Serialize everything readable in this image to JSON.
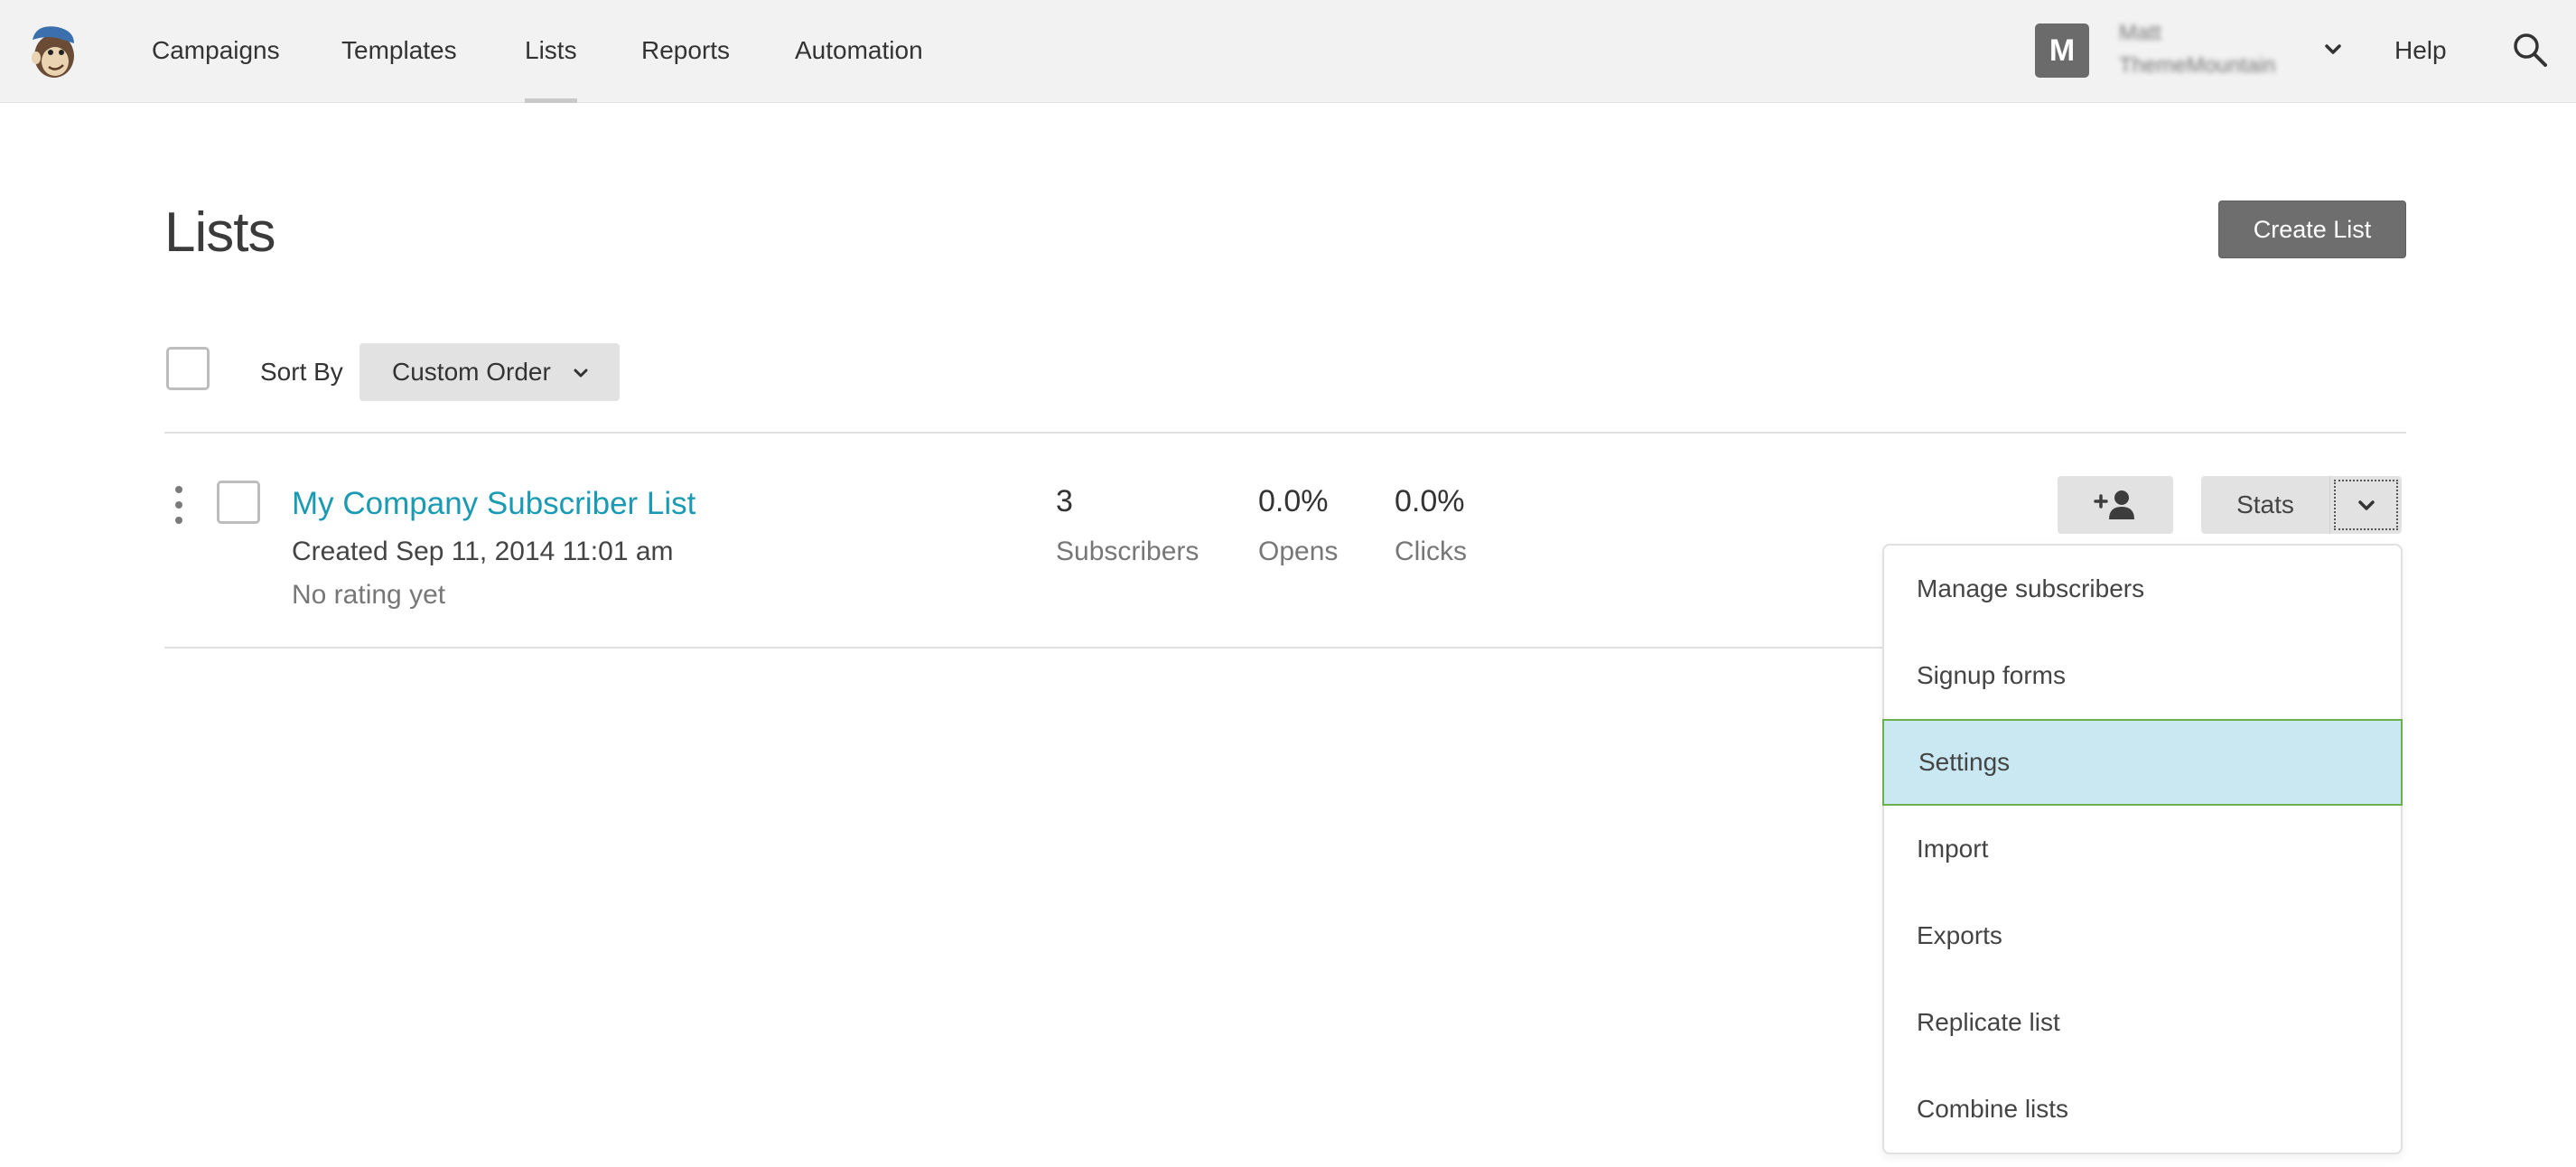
{
  "nav": {
    "items": [
      {
        "label": "Campaigns"
      },
      {
        "label": "Templates"
      },
      {
        "label": "Lists",
        "active": true
      },
      {
        "label": "Reports"
      },
      {
        "label": "Automation"
      }
    ],
    "user": {
      "initial": "M",
      "name": "Matt",
      "org": "ThemeMountain"
    },
    "help": "Help"
  },
  "page": {
    "title": "Lists",
    "create_button": "Create List",
    "sort_label": "Sort By",
    "sort_value": "Custom Order"
  },
  "list": {
    "name": "My Company Subscriber List",
    "created": "Created Sep 11, 2014 11:01 am",
    "rating": "No rating yet",
    "stats": [
      {
        "value": "3",
        "label": "Subscribers"
      },
      {
        "value": "0.0%",
        "label": "Opens"
      },
      {
        "value": "0.0%",
        "label": "Clicks"
      }
    ],
    "stats_button": "Stats"
  },
  "menu": {
    "items": [
      {
        "label": "Manage subscribers"
      },
      {
        "label": "Signup forms"
      },
      {
        "label": "Settings",
        "highlighted": true
      },
      {
        "label": "Import"
      },
      {
        "label": "Exports"
      },
      {
        "label": "Replicate list"
      },
      {
        "label": "Combine lists"
      }
    ]
  },
  "colors": {
    "link": "#1b9ab3",
    "highlight": "#c9e8f2",
    "highlight_border": "#6ab04c",
    "button_dark": "#6e6e6e"
  },
  "icons": [
    "mailchimp-logo-icon",
    "chevron-down-icon",
    "search-icon",
    "drag-handle-icon",
    "add-subscriber-icon"
  ]
}
